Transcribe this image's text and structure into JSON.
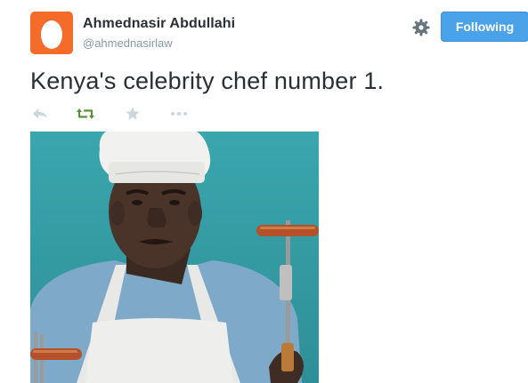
{
  "tweet": {
    "author": {
      "name": "Ahmednasir Abdullahi",
      "handle": "@ahmednasirlaw",
      "avatar_color": "#f46b2a"
    },
    "follow_label": "Following",
    "text": "Kenya's celebrity chef number 1.",
    "actions": {
      "reply_icon": "reply-icon",
      "retweet_icon": "retweet-icon",
      "retweet_color": "#5c913b",
      "favorite_icon": "star-icon",
      "more_icon": "more-icon"
    },
    "media": {
      "subject": "man in white chef hat and apron holding sausages on forks"
    }
  }
}
